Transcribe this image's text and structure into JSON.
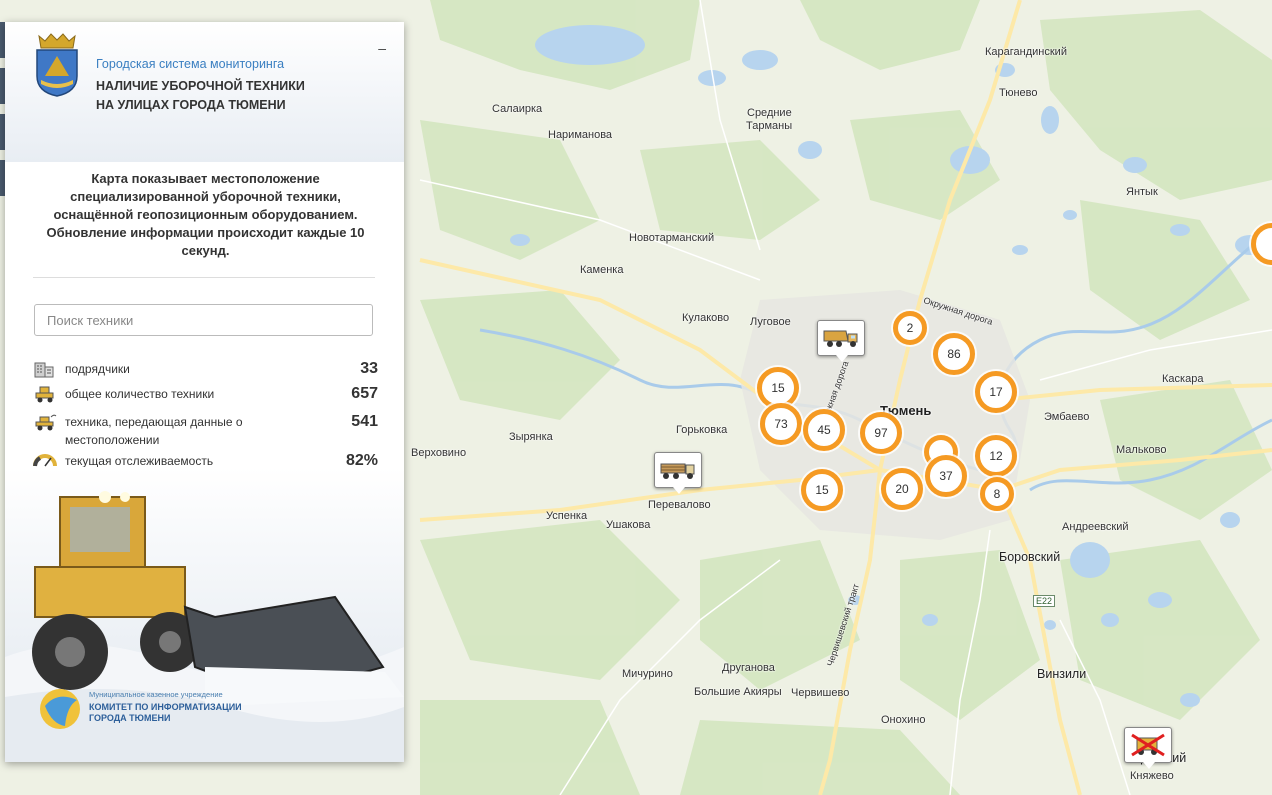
{
  "panel": {
    "subtitle": "Городская система мониторинга",
    "title_line1": "НАЛИЧИЕ УБОРОЧНОЙ ТЕХНИКИ",
    "title_line2": "НА УЛИЦАХ ГОРОДА ТЮМЕНИ",
    "collapse_label": "–",
    "description": "Карта показывает местоположение специализированной уборочной техники, оснащённой геопозиционным оборудованием. Обновление информации происходит каждые 10 секунд.",
    "search": {
      "placeholder": "Поиск техники",
      "value": ""
    },
    "stats": [
      {
        "label": "подрядчики",
        "value": "33",
        "icon": "building-icon"
      },
      {
        "label": "общее количество техники",
        "value": "657",
        "icon": "loader-icon"
      },
      {
        "label": "техника, передающая данные о местоположении",
        "value": "541",
        "icon": "loader-signal-icon"
      },
      {
        "label": "текущая отслеживаемость",
        "value": "82%",
        "icon": "gauge-icon"
      }
    ],
    "org": {
      "line1": "Муниципальное казенное учреждение",
      "line2": "КОМИТЕТ ПО ИНФОРМАТИЗАЦИИ",
      "line3": "ГОРОДА ТЮМЕНИ"
    }
  },
  "map": {
    "places": [
      "Карагандинский",
      "Тюнево",
      "Салаирка",
      "Нариманова",
      "Средние",
      "Тарманы",
      "Янтык",
      "Новотарманский",
      "Каменка",
      "Кулаково",
      "Луговое",
      "Окружная дорога",
      "Тюмень",
      "Каскара",
      "Эмбаево",
      "Горьковка",
      "Зырянка",
      "Верховино",
      "Мальково",
      "Андреевский",
      "Перевалово",
      "Успенка",
      "Ушакова",
      "Боровский",
      "Е22",
      "Мичурино",
      "Друганова",
      "Большие Акияры",
      "Червишево",
      "Червишевский тракт",
      "Винзили",
      "Онохино",
      "Боровский",
      "Княжево",
      "Южная дорога"
    ],
    "clusters": [
      "2",
      "86",
      "15",
      "17",
      "73",
      "45",
      "97",
      "12",
      "37",
      "20",
      "15",
      "8"
    ]
  },
  "colors": {
    "cluster": "#f59a23",
    "accent": "#3a7fc1"
  }
}
